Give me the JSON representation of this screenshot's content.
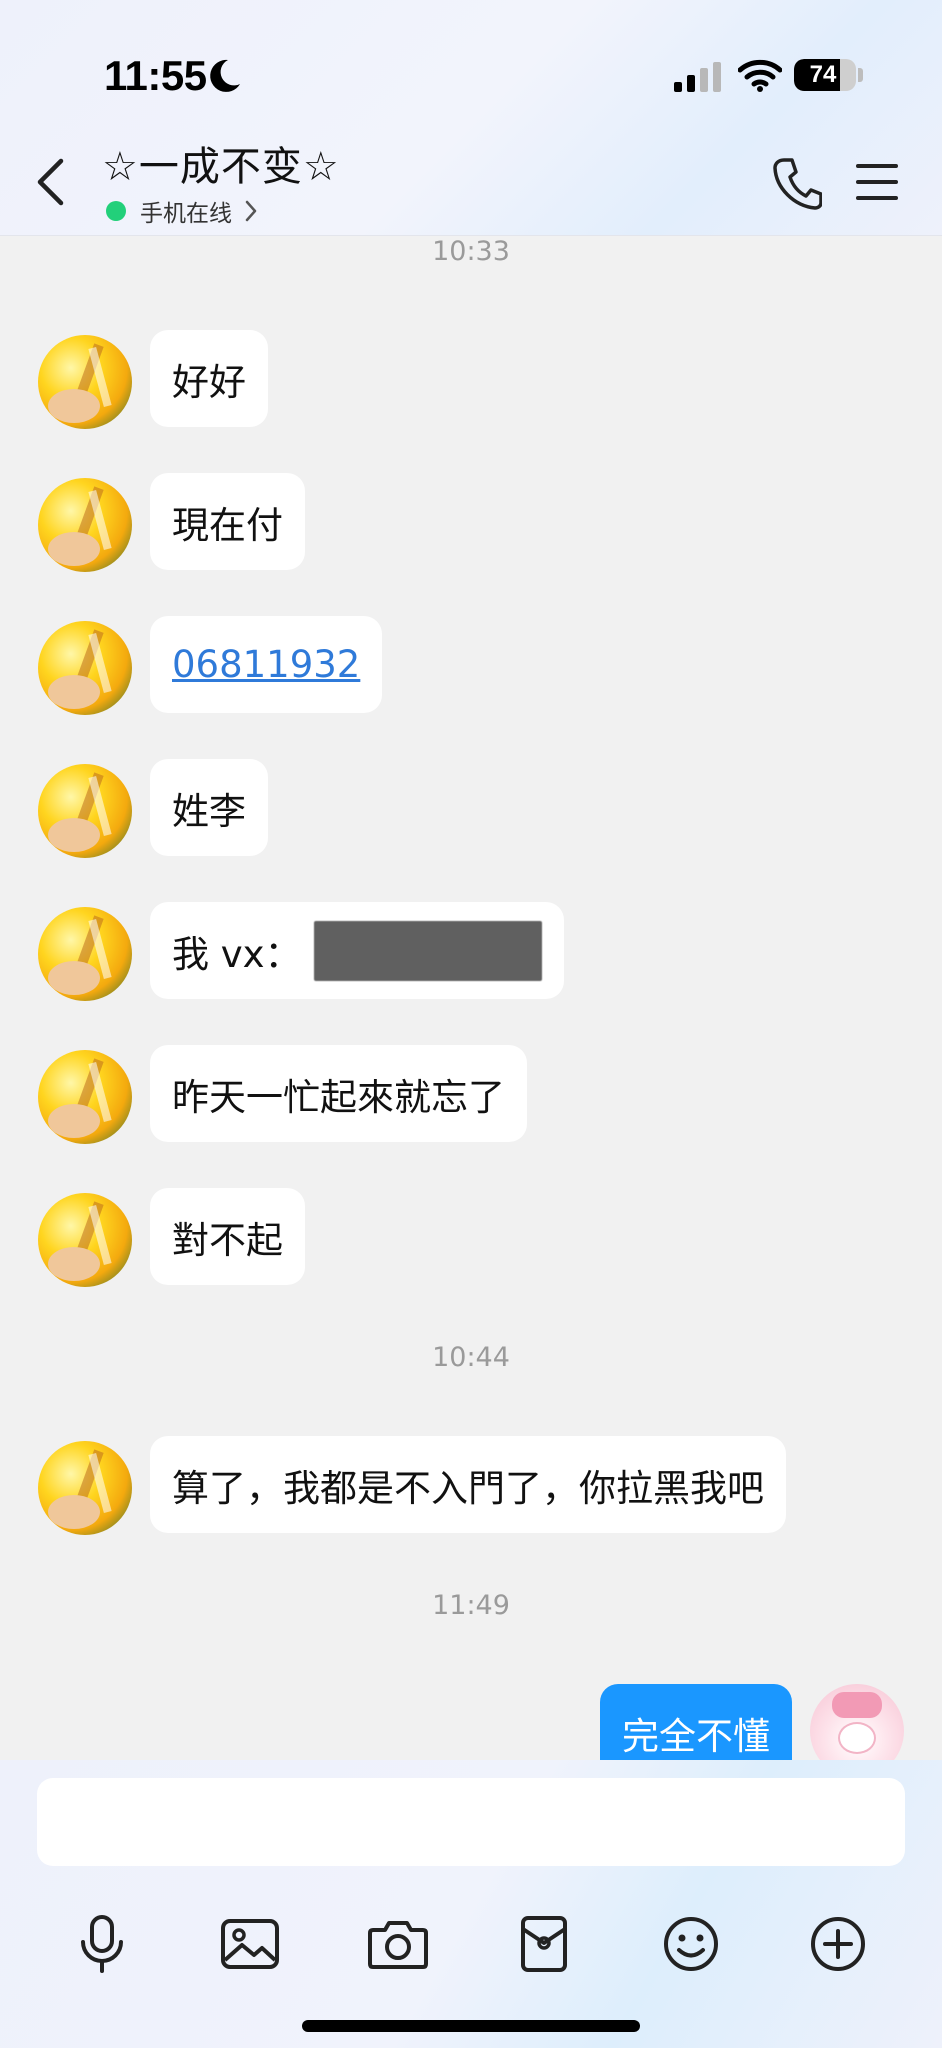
{
  "status_bar": {
    "time": "11:55",
    "battery": "74",
    "battery_level": 0.74,
    "icons": [
      "moon-icon",
      "signal-icon",
      "wifi-icon",
      "battery-icon"
    ]
  },
  "header": {
    "contact_name": "☆一成不变☆",
    "online_status": "手机在线",
    "icons": [
      "back-arrow-icon",
      "chevron-right-icon",
      "phone-icon",
      "menu-icon"
    ]
  },
  "chat": {
    "timestamps": [
      "10:33",
      "10:44",
      "11:49"
    ],
    "incoming": [
      {
        "text": "好好"
      },
      {
        "text": "現在付"
      },
      {
        "text": "06811932",
        "is_link": true
      },
      {
        "text": "姓李"
      },
      {
        "text": "我 vx：",
        "redacted": true
      },
      {
        "text": "昨天一忙起來就忘了"
      },
      {
        "text": "對不起"
      },
      {
        "text": "算了，我都是不入門了，你拉黑我吧"
      }
    ],
    "outgoing": [
      {
        "text": "完全不懂"
      }
    ]
  },
  "input": {
    "value": "",
    "placeholder": ""
  },
  "toolbar": {
    "icons": [
      "microphone-icon",
      "image-icon",
      "camera-icon",
      "red-packet-icon",
      "emoji-icon",
      "plus-icon"
    ]
  },
  "colors": {
    "outgoing_bubble": "#1a97ff",
    "online_dot": "#22d07a",
    "link": "#2f7ad9"
  }
}
